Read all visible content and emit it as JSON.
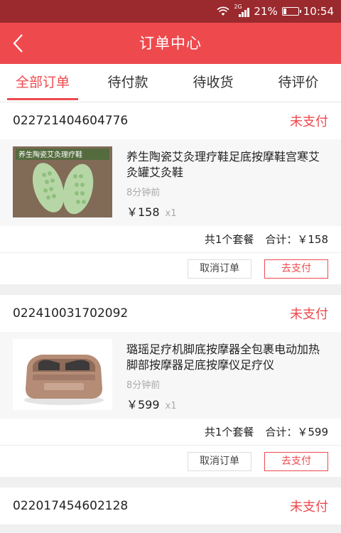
{
  "status_bar": {
    "network": "2G",
    "battery": "21%",
    "battery_level": 0.21,
    "time": "10:54"
  },
  "nav": {
    "back_icon": "chevron-left-icon",
    "title": "订单中心"
  },
  "tabs": [
    {
      "label": "全部订单",
      "active": true
    },
    {
      "label": "待付款",
      "active": false
    },
    {
      "label": "待收货",
      "active": false
    },
    {
      "label": "待评价",
      "active": false
    }
  ],
  "orders": [
    {
      "order_no": "022721404604776",
      "status": "未支付",
      "item": {
        "image_text": "养生陶瓷艾灸理疗鞋",
        "title": "养生陶瓷艾灸理疗鞋足底按摩鞋宫寒艾灸罐艾灸鞋",
        "time": "8分钟前",
        "price": "￥158",
        "qty": "x1"
      },
      "summary": {
        "count": "共1个套餐",
        "total": "合计：￥158"
      },
      "actions": {
        "cancel": "取消订单",
        "pay": "去支付"
      }
    },
    {
      "order_no": "022410031702092",
      "status": "未支付",
      "item": {
        "title": "璐瑶足疗机脚底按摩器全包裹电动加热脚部按摩器足底按摩仪足疗仪",
        "time": "8分钟前",
        "price": "￥599",
        "qty": "x1"
      },
      "summary": {
        "count": "共1个套餐",
        "total": "合计：￥599"
      },
      "actions": {
        "cancel": "取消订单",
        "pay": "去支付"
      }
    },
    {
      "order_no": "022017454602128",
      "status": "未支付"
    }
  ],
  "colors": {
    "accent": "#ee4a4e",
    "status_bar": "#9a2a2e"
  }
}
